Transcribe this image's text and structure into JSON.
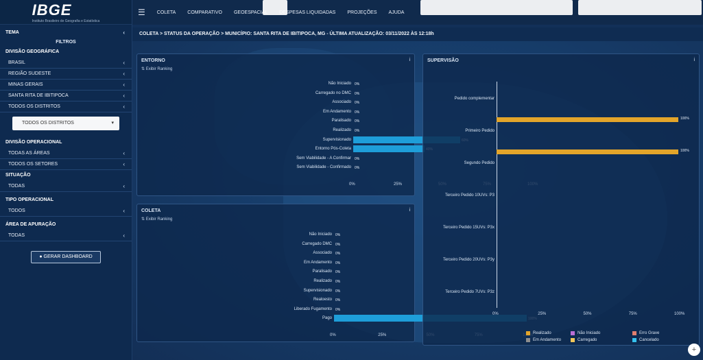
{
  "sidebar": {
    "logo": "IBGE",
    "logo_sub": "Instituto Brasileiro de Geografia e Estatística",
    "tema": "TEMA",
    "filtros": "FILTROS",
    "divisao_geografica": "DIVISÃO GEOGRÁFICA",
    "geo_items": [
      "BRASIL",
      "REGIÃO SUDESTE",
      "MINAS GERAIS",
      "SANTA RITA DE IBITIPOCA",
      "TODOS OS DISTRITOS"
    ],
    "dropdown": "TODOS OS DISTRITOS",
    "divisao_operacional": "DIVISÃO OPERACIONAL",
    "op_items": [
      "TODAS AS ÁREAS",
      "TODOS OS SETORES"
    ],
    "situacao": "SITUAÇÃO",
    "situacao_value": "TODAS",
    "tipo_operacional": "TIPO OPERACIONAL",
    "tipo_value": "TODOS",
    "area_apuracao": "ÁREA DE APURAÇÃO",
    "area_value": "TODAS",
    "generate_btn": "GERAR DASHBOARD"
  },
  "topnav": {
    "items": [
      "COLETA",
      "COMPARATIVO",
      "GEOESPACIAL",
      "DESPESAS LIQUIDADAS",
      "PROJEÇÕES",
      "AJUDA"
    ]
  },
  "breadcrumb": "COLETA > STATUS DA OPERAÇÃO > MUNICÍPIO: SANTA RITA DE IBITIPOCA, MG - ÚLTIMA ATUALIZAÇÃO: 03/11/2022 ÀS 12:18h",
  "panels": {
    "entorno": {
      "title": "ENTORNO",
      "rank": "Exibir Ranking",
      "info": "i"
    },
    "coleta": {
      "title": "COLETA",
      "rank": "Exibir Ranking",
      "info": "i"
    },
    "supervisao": {
      "title": "SUPERVISÃO",
      "info": "i"
    }
  },
  "chart_data": [
    {
      "type": "bar",
      "orientation": "horizontal",
      "title": "ENTORNO",
      "categories": [
        "Não Iniciado",
        "Carregado no DMC",
        "Associado",
        "Em Andamento",
        "Paralisado",
        "Realizado",
        "Supervisionado",
        "Entorno Pós-Coleta",
        "Sem Viabilidade - A Confirmar",
        "Sem Viabilidade - Confirmado"
      ],
      "values": [
        0,
        0,
        0,
        0,
        0,
        0,
        60,
        40,
        0,
        0
      ],
      "labels": [
        "0%",
        "0%",
        "0%",
        "0%",
        "0%",
        "0%",
        "60%",
        "40%",
        "0%",
        "0%"
      ],
      "xticks": [
        "0%",
        "25%",
        "50%",
        "75%",
        "100%"
      ],
      "xlim": [
        0,
        100
      ],
      "color": "#1e9ed9"
    },
    {
      "type": "bar",
      "orientation": "horizontal",
      "title": "COLETA",
      "categories": [
        "Não Iniciado",
        "Carregado DMC",
        "Associado",
        "Em Andamento",
        "Paralisado",
        "Realizado",
        "Supervisionado",
        "Realoesto",
        "Liberado Fugamento",
        "Pago"
      ],
      "values": [
        0,
        0,
        0,
        0,
        0,
        0,
        0,
        0,
        0,
        100
      ],
      "labels": [
        "0%",
        "0%",
        "0%",
        "0%",
        "0%",
        "0%",
        "0%",
        "0%",
        "0%",
        "100%"
      ],
      "xticks": [
        "0%",
        "25%",
        "50%",
        "75%",
        "100%"
      ],
      "xlim": [
        0,
        100
      ],
      "color": "#1e9ed9"
    },
    {
      "type": "bar",
      "orientation": "horizontal",
      "title": "SUPERVISÃO",
      "categories": [
        "Pedido complementar",
        "Primeiro Pedido",
        "Segundo Pedido",
        "Terceiro Pedido 10UVs: P3",
        "Terceiro Pedido 15UVs: P3x",
        "Terceiro Pedido 20UVs: P3y",
        "Terceiro Pedido 7UVs: P3z"
      ],
      "series": [
        {
          "name": "Realizado",
          "values": [
            0,
            100,
            100,
            0,
            0,
            0,
            0
          ],
          "color": "#e3a52a"
        },
        {
          "name": "Não Iniciado",
          "values": [
            0,
            0,
            0,
            0,
            0,
            0,
            0
          ],
          "color": "#b96fd6"
        },
        {
          "name": "Erro Grave",
          "values": [
            0,
            0,
            0,
            0,
            0,
            0,
            0
          ],
          "color": "#e07f6e"
        },
        {
          "name": "Em Andamento",
          "values": [
            0,
            0,
            0,
            0,
            0,
            0,
            0
          ],
          "color": "#8d8d8d"
        },
        {
          "name": "Carregado",
          "values": [
            0,
            0,
            0,
            0,
            0,
            0,
            0
          ],
          "color": "#f0c65a"
        },
        {
          "name": "Cancelado",
          "values": [
            0,
            0,
            0,
            0,
            0,
            0,
            0
          ],
          "color": "#35c1ee"
        }
      ],
      "bar_labels": [
        "100%",
        "100%"
      ],
      "xticks": [
        "0%",
        "25%",
        "50%",
        "75%",
        "100%"
      ],
      "xlim": [
        0,
        100
      ],
      "legend": "bottom-right"
    }
  ]
}
